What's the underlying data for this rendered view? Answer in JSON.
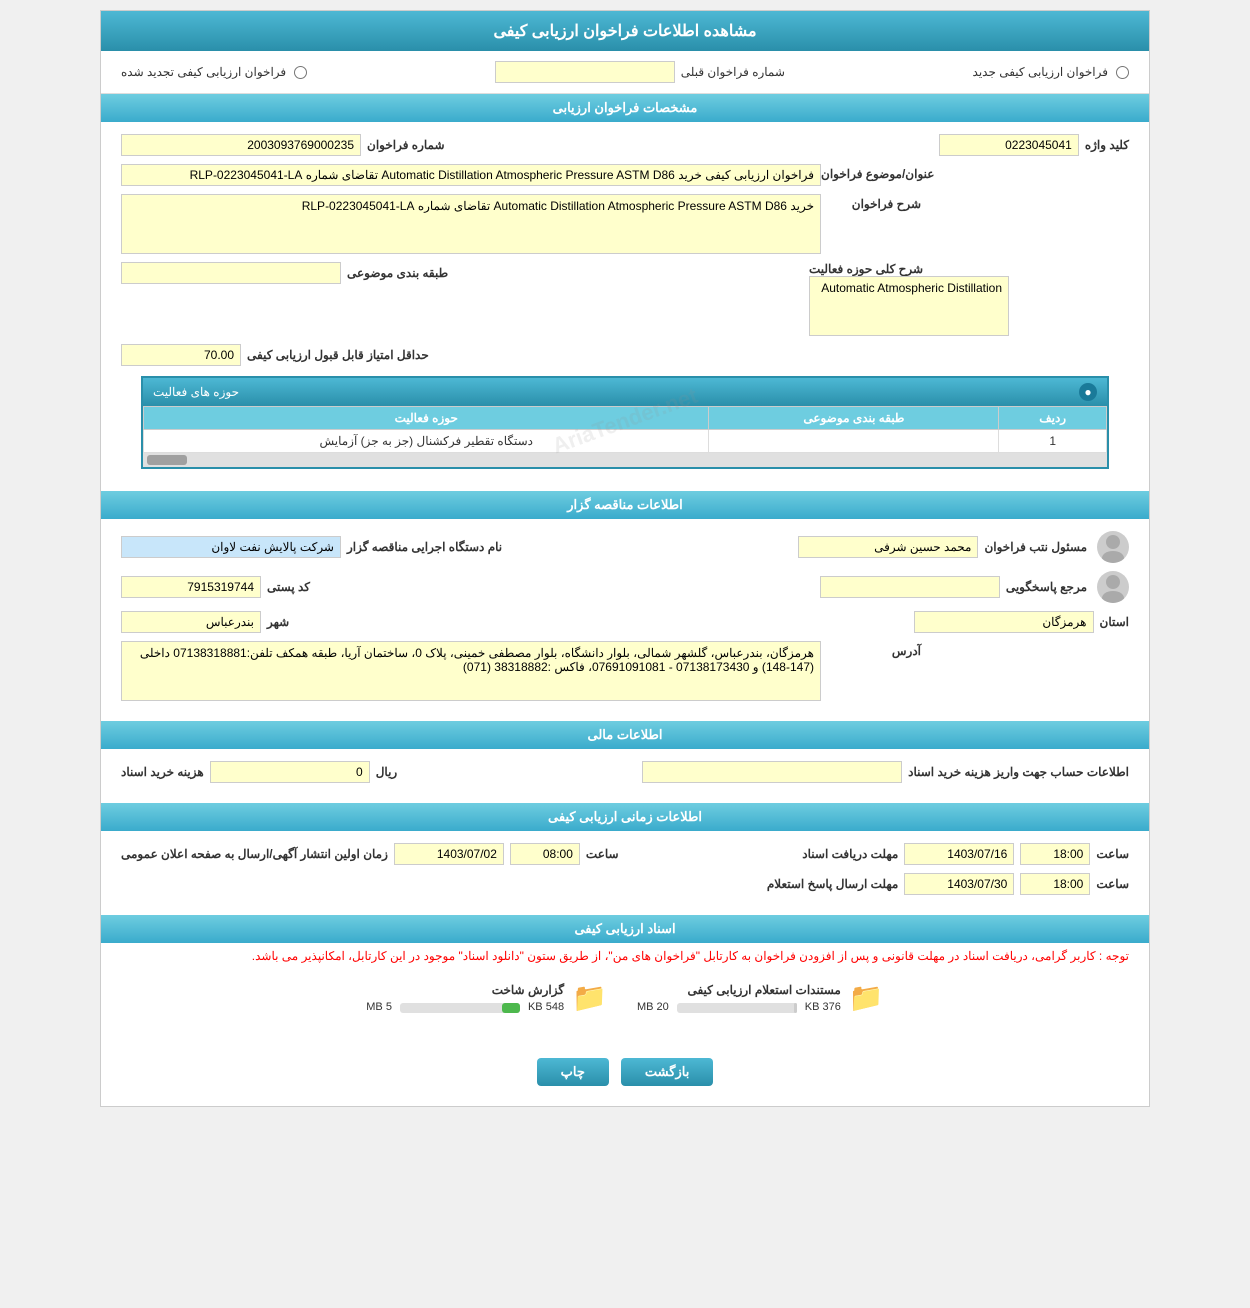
{
  "page": {
    "title": "مشاهده اطلاعات فراخوان ارزیابی کیفی"
  },
  "top_bar": {
    "new_label": "فراخوان ارزیابی کیفی جدید",
    "renewed_label": "فراخوان ارزیابی کیفی تجدید شده",
    "prev_number_label": "شماره فراخوان قبلی"
  },
  "section1": {
    "title": "مشخصات فراخوان ارزیابی",
    "fields": {
      "number_label": "شماره فراخوان",
      "number_value": "2003093769000235",
      "keyword_label": "کلید واژه",
      "keyword_value": "0223045041",
      "title_label": "عنوان/موضوع فراخوان",
      "title_value": "فراخوان ارزیابی کیفی خرید Automatic Distillation Atmospheric Pressure ASTM D86 تقاضای شماره RLP-0223045041-LA",
      "desc_label": "شرح فراخوان",
      "desc_value": "خرید Automatic Distillation Atmospheric Pressure ASTM D86 تقاضای شماره RLP-0223045041-LA",
      "category_label": "طبقه بندی موضوعی",
      "category_value": "",
      "activity_label": "شرح کلی حوزه فعالیت",
      "activity_value": "Automatic Atmospheric Distillation",
      "min_score_label": "حداقل امتیاز قابل قبول ارزیابی کیفی",
      "min_score_value": "70.00"
    }
  },
  "activity_popup": {
    "title": "حوزه های فعالیت",
    "col_row": "ردیف",
    "col_category": "طبقه بندی موضوعی",
    "col_activity": "حوزه فعالیت",
    "rows": [
      {
        "row": "1",
        "category": "",
        "activity": "دستگاه تقطیر فرکشنال (جز به جز) آزمایش"
      }
    ]
  },
  "section2": {
    "title": "اطلاعات مناقصه گزار",
    "org_label": "نام دستگاه اجرایی مناقصه گزار",
    "org_value": "شرکت پالایش نفت لاوان",
    "contact_label": "مسئول نتب فراخوان",
    "contact_value": "محمد حسین شرفی",
    "postal_label": "کد پستی",
    "postal_value": "7915319744",
    "ref_label": "مرجع پاسخگویی",
    "ref_value": "",
    "city_label": "شهر",
    "city_value": "بندرعباس",
    "province_label": "استان",
    "province_value": "هرمزگان",
    "address_label": "آدرس",
    "address_value": "هرمزگان، بندرعباس، گلشهر شمالی، بلوار دانشگاه، بلوار مصطفی خمینی، پلاک 0، ساختمان آریا، طبقه همکف تلفن:07138318881 داخلی (147-148) و 07138173430 - 07691091081، فاکس :38318882 (071)"
  },
  "section3": {
    "title": "اطلاعات مالی",
    "cost_label": "هزینه خرید اسناد",
    "cost_unit": "ریال",
    "cost_value": "0",
    "account_label": "اطلاعات حساب جهت واریز هزینه خرید اسناد",
    "account_value": ""
  },
  "section4": {
    "title": "اطلاعات زمانی ارزیابی کیفی",
    "publish_label": "زمان اولین انتشار آگهی/ارسال به صفحه اعلان عمومی",
    "publish_date": "1403/07/02",
    "publish_time": "08:00",
    "publish_time_label": "ساعت",
    "deadline_label": "مهلت دریافت اسناد",
    "deadline_date": "1403/07/16",
    "deadline_time": "18:00",
    "deadline_time_label": "ساعت",
    "response_label": "مهلت ارسال پاسخ استعلام",
    "response_date": "1403/07/30",
    "response_time": "18:00",
    "response_time_label": "ساعت"
  },
  "section5": {
    "title": "اسناد ارزیابی کیفی",
    "notice": "توجه : کاربر گرامی، دریافت اسناد در مهلت قانونی و پس از افزودن فراخوان به کارتابل \"فراخوان های من\"، از طریق ستون \"دانلود اسناد\" موجود در این کارتابل، امکانپذیر می باشد.",
    "file1_label": "مستندات استعلام ارزیابی کیفی",
    "file1_size1": "376 KB",
    "file1_size2": "20 MB",
    "file1_progress": 2,
    "file1_progress_color": "#ccc",
    "file2_label": "گزارش شاخت",
    "file2_size1": "548 KB",
    "file2_size2": "5 MB",
    "file2_progress": 15,
    "file2_progress_color": "#4db84d"
  },
  "buttons": {
    "print_label": "چاپ",
    "back_label": "بازگشت"
  }
}
